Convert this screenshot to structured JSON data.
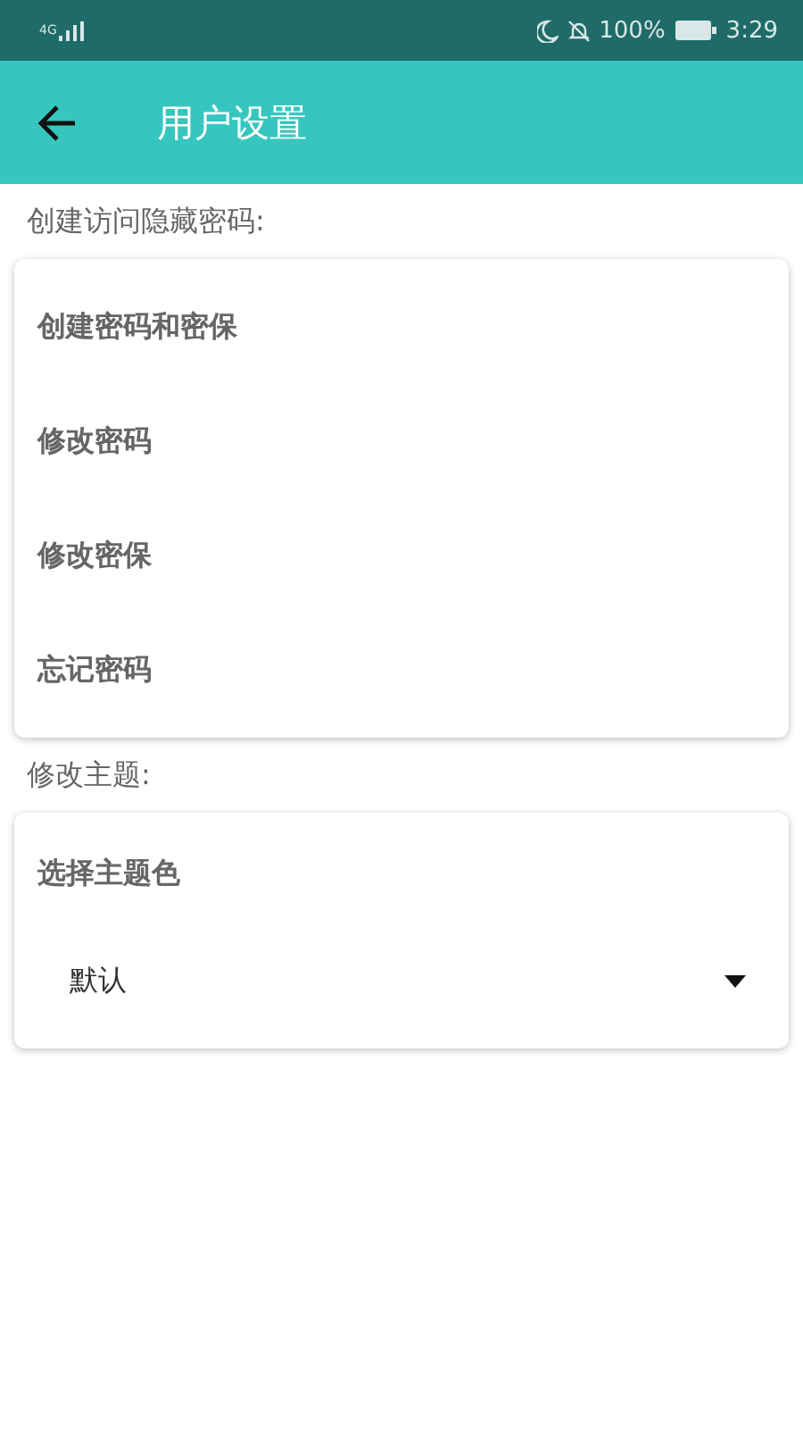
{
  "status_bar": {
    "network": "4G",
    "battery": "100%",
    "time": "3:29"
  },
  "app_bar": {
    "title": "用户设置"
  },
  "sections": [
    {
      "label": "创建访问隐藏密码:",
      "items": [
        {
          "kind": "link",
          "text": "创建密码和密保"
        },
        {
          "kind": "link",
          "text": "修改密码"
        },
        {
          "kind": "link",
          "text": "修改密保"
        },
        {
          "kind": "link",
          "text": "忘记密码"
        }
      ]
    },
    {
      "label": "修改主题:",
      "items": [
        {
          "kind": "heading",
          "text": "选择主题色"
        },
        {
          "kind": "dropdown",
          "text": "默认"
        }
      ]
    }
  ]
}
